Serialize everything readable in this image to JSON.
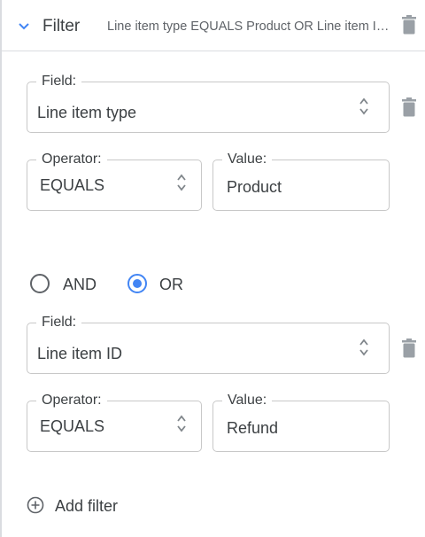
{
  "header": {
    "title": "Filter",
    "summary": "Line item type EQUALS Product OR Line item ID EQUALS Refund"
  },
  "conditions": [
    {
      "field_legend": "Field:",
      "field_value": "Line item type",
      "operator_legend": "Operator:",
      "operator_value": "EQUALS",
      "value_legend": "Value:",
      "value": "Product"
    },
    {
      "field_legend": "Field:",
      "field_value": "Line item ID",
      "operator_legend": "Operator:",
      "operator_value": "EQUALS",
      "value_legend": "Value:",
      "value": "Refund"
    }
  ],
  "logic": {
    "and_label": "AND",
    "or_label": "OR",
    "selected": "OR"
  },
  "footer": {
    "add_filter_label": "Add filter"
  },
  "colors": {
    "accent": "#4285f4",
    "icon": "#9aa0a6",
    "text": "#3c4043",
    "border": "#c8c8c8"
  },
  "icons": [
    "chevron-down-icon",
    "trash-icon",
    "sort-arrows-icon",
    "add-circle-icon"
  ]
}
